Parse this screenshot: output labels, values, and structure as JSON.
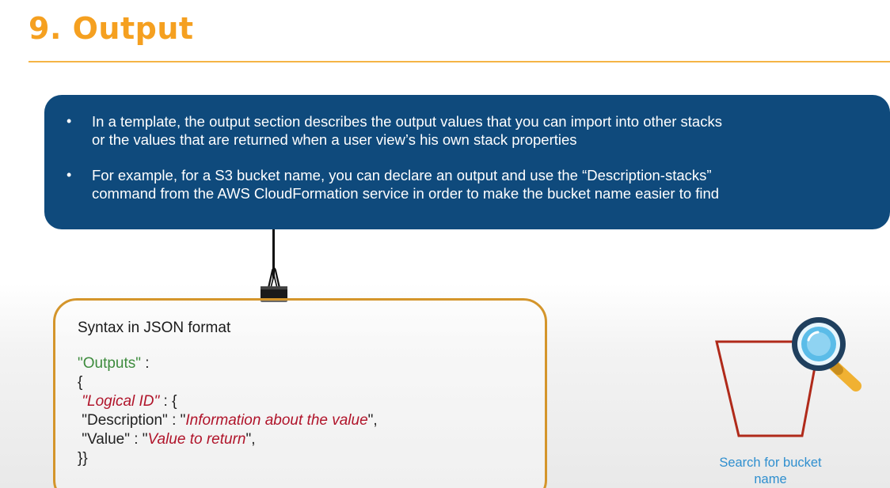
{
  "slide": {
    "title": "9. Output"
  },
  "info_box": {
    "bullets": [
      {
        "line1": "In a template, the output section describes the output values that you can import into other stacks",
        "line2": "or the values that are returned when a user view’s his own stack properties"
      },
      {
        "line1": "For example, for a S3 bucket name, you can declare an output and use the “Description-stacks”",
        "line2": "command from the AWS CloudFormation service in order to make the bucket name easier to find"
      }
    ]
  },
  "code_box": {
    "heading": "Syntax in JSON format",
    "outputs_key": "\"Outputs\"",
    "colon": " :",
    "open_brace": "{",
    "logical_id_q1": " \"",
    "logical_id": "Logical ID",
    "logical_id_q2": "\"",
    "logical_id_rest": " : {",
    "description_key": " \"Description\" : \"",
    "description_value": "Information about the value",
    "description_end": "\",",
    "value_key": " \"Value\" : \"",
    "value_value": "Value to return",
    "value_end": "\",",
    "close_braces": "}}"
  },
  "illustration": {
    "caption_line1": "Search for bucket",
    "caption_line2": "name",
    "icons": [
      "bucket-icon",
      "magnifier-icon",
      "binder-clip-icon"
    ],
    "colors": {
      "bucket_outline": "#b02a1a",
      "magnifier_frame": "#1f3f5e",
      "magnifier_lens": "#5bbce8",
      "magnifier_handle": "#f0b132"
    }
  },
  "theme": {
    "title_color": "#f5a020",
    "info_box_bg": "#0f4a7c",
    "code_box_border": "#d4952b"
  }
}
